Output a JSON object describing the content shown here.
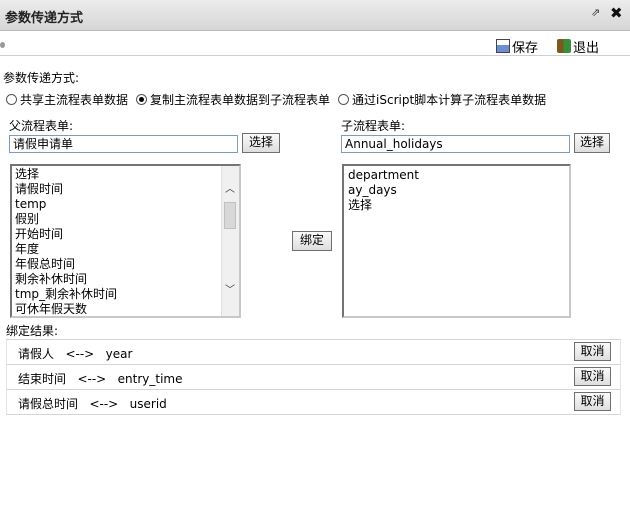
{
  "window": {
    "title": "参数传递方式",
    "popout_glyph": "⇗",
    "close_glyph": "✖"
  },
  "toolbar": {
    "save_label": "保存",
    "exit_label": "退出"
  },
  "mode": {
    "label": "参数传递方式:",
    "options": [
      {
        "label": "共享主流程表单数据",
        "selected": false
      },
      {
        "label": "复制主流程表单数据到子流程表单",
        "selected": true
      },
      {
        "label": "通过iScript脚本计算子流程表单数据",
        "selected": false
      }
    ]
  },
  "parent_form": {
    "label": "父流程表单:",
    "value": "请假申请单",
    "select_label": "选择",
    "fields": [
      "选择",
      "请假时间",
      "temp",
      "假别",
      "开始时间",
      "年度",
      "年假总时间",
      "剩余补休时间",
      "tmp_剩余补休时间",
      "可休年假天数"
    ]
  },
  "child_form": {
    "label": "子流程表单:",
    "value": "Annual_holidays",
    "select_label": "选择",
    "fields": [
      "department",
      "ay_days",
      "选择"
    ]
  },
  "bind_button": "绑定",
  "results": {
    "label": "绑定结果:",
    "rows": [
      {
        "text": "请假人   <-->   year",
        "cancel": "取消"
      },
      {
        "text": "结束时间   <-->   entry_time",
        "cancel": "取消"
      },
      {
        "text": "请假总时间   <-->   userid",
        "cancel": "取消"
      }
    ]
  }
}
